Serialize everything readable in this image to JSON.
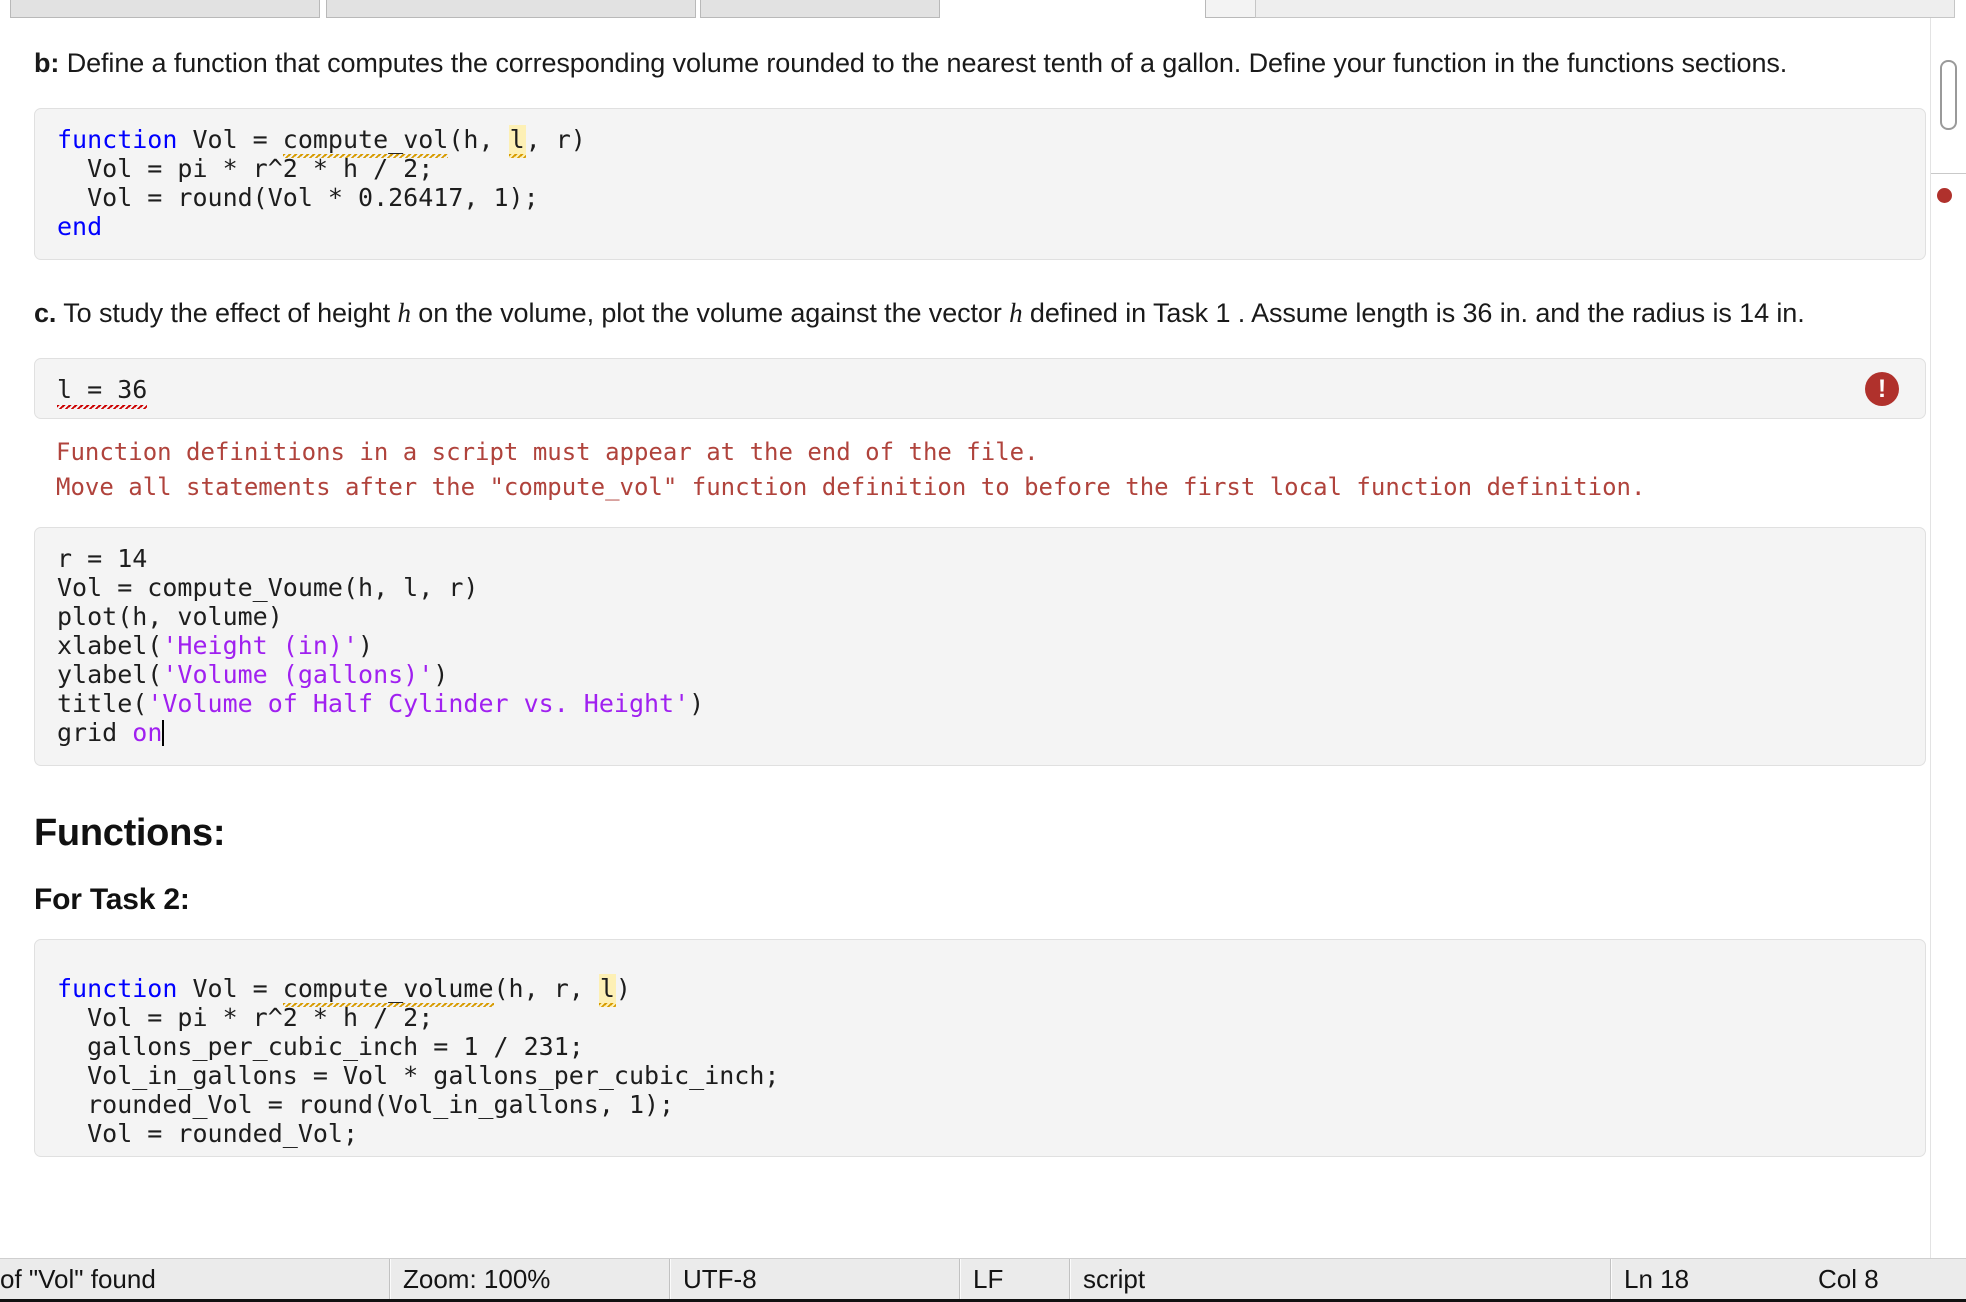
{
  "window": {
    "tabs": [
      {
        "label": "",
        "state": "inactive"
      },
      {
        "label": "",
        "state": "inactive"
      },
      {
        "label": "",
        "state": "inactive"
      },
      {
        "label": "",
        "state": "plain"
      },
      {
        "label": "",
        "state": "active"
      },
      {
        "label": "",
        "state": "inactive"
      }
    ]
  },
  "document": {
    "part_b": {
      "marker": "b:",
      "text": " Define a function that computes the corresponding volume rounded to the nearest tenth of a gallon. Define your function in the functions sections."
    },
    "code_b": {
      "line1_kw": "function",
      "line1_mid": " Vol = ",
      "line1_fn": "compute_vol",
      "line1_args_a": "(h, ",
      "line1_l": "l",
      "line1_args_b": ", r)",
      "line2": "  Vol = pi * r^2 * h / 2;",
      "line3": "  Vol = round(Vol * 0.26417, 1);",
      "line4_kw": "end"
    },
    "part_c": {
      "marker": "c.",
      "seg1": " To study the effect of height ",
      "var1": "h",
      "seg2": " on the volume, plot the volume against the vector ",
      "var2": "h",
      "seg3": " defined in Task 1 . Assume length is 36 in. and the radius is 14 in."
    },
    "code_l": {
      "text": "l = 36",
      "error_badge": "!"
    },
    "error_message": {
      "line1": "Function definitions in a script must appear at the end of the file.",
      "line2": "Move all statements after the \"compute_vol\" function definition to before the first local function definition."
    },
    "code_plot": {
      "line1": "r = 14",
      "line2": "Vol = compute_Voume(h, l, r)",
      "line3": "plot(h, volume)",
      "line4_fn": "xlabel(",
      "line4_str": "'Height (in)'",
      "line4_end": ")",
      "line5_fn": "ylabel(",
      "line5_str": "'Volume (gallons)'",
      "line5_end": ")",
      "line6_fn": "title(",
      "line6_str": "'Volume of Half Cylinder vs. Height'",
      "line6_end": ")",
      "line7_fn": "grid ",
      "line7_str": "on"
    },
    "heading_functions": "Functions:",
    "heading_task2": "For Task 2:",
    "code_task2": {
      "line1_kw": "function",
      "line1_mid": " Vol = ",
      "line1_fn": "compute_volume",
      "line1_args_a": "(h, r, ",
      "line1_l": "l",
      "line1_args_b": ")",
      "line2": "  Vol = pi * r^2 * h / 2;",
      "line3": "  gallons_per_cubic_inch = 1 / 231;",
      "line4": "  Vol_in_gallons = Vol * gallons_per_cubic_inch;",
      "line5": "  rounded_Vol = round(Vol_in_gallons, 1);",
      "line6": "  Vol = rounded_Vol;"
    }
  },
  "statusbar": {
    "message": "of \"Vol\" found",
    "zoom": "Zoom: 100%",
    "encoding": "UTF-8",
    "line_ending": "LF",
    "file_type": "script",
    "line": "Ln  18",
    "column": "Col  8"
  },
  "colors": {
    "keyword": "#0000ff",
    "string": "#a020f0",
    "error": "#b0433c",
    "error_badge": "#b0312c",
    "code_bg": "#f4f4f4",
    "highlight": "#fdf0b5"
  }
}
